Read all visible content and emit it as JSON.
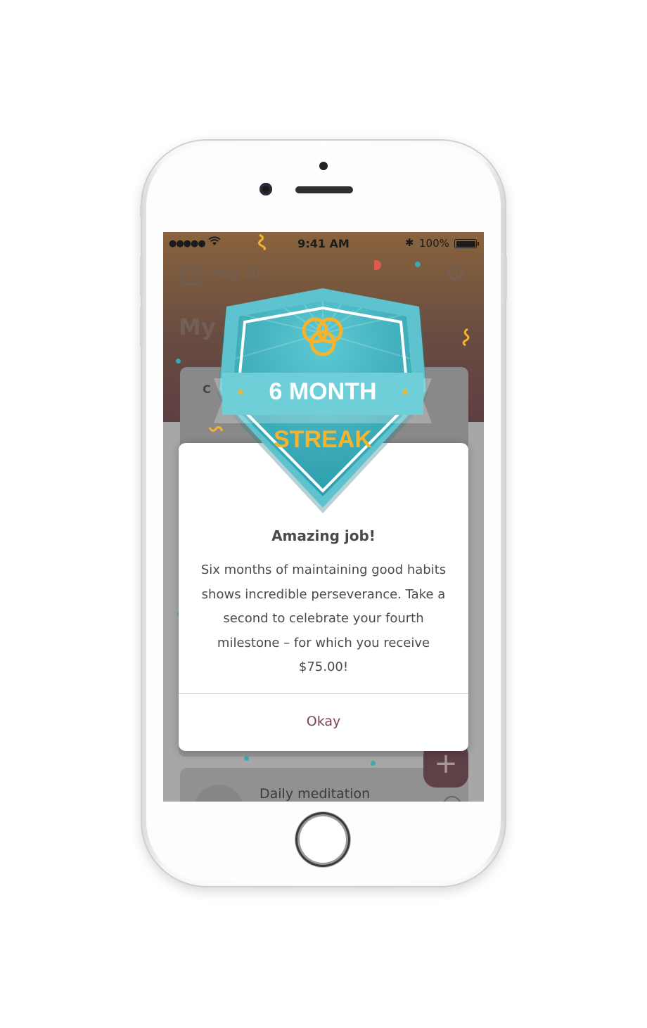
{
  "status_bar": {
    "signal": "●●●●●",
    "time": "9:41 AM",
    "bluetooth": "✱",
    "battery": "100%"
  },
  "header": {
    "date": "Aug 10",
    "chevron": "⌵",
    "settings_icon": "⚙",
    "title": "My"
  },
  "card_top": {
    "label": "C"
  },
  "habit": {
    "name": "Daily meditation"
  },
  "fab": {
    "label": "+"
  },
  "badge": {
    "line1": "6 MONTH",
    "line2": "STREAK",
    "star": "★",
    "colors": {
      "teal": "#4cb8c4",
      "teal_dark": "#2f9aa7",
      "gold": "#f5b32e",
      "white": "#ffffff"
    }
  },
  "modal": {
    "title": "Amazing job!",
    "body": "Six months of maintaining good habits shows incredible perseverance. Take a second to celebrate your fourth milestone – for which you receive $75.00!",
    "okay": "Okay"
  },
  "colors": {
    "header_top": "#b8742e",
    "header_bottom": "#6b3138",
    "accent": "#6b3440",
    "okay_text": "#7a4552"
  }
}
